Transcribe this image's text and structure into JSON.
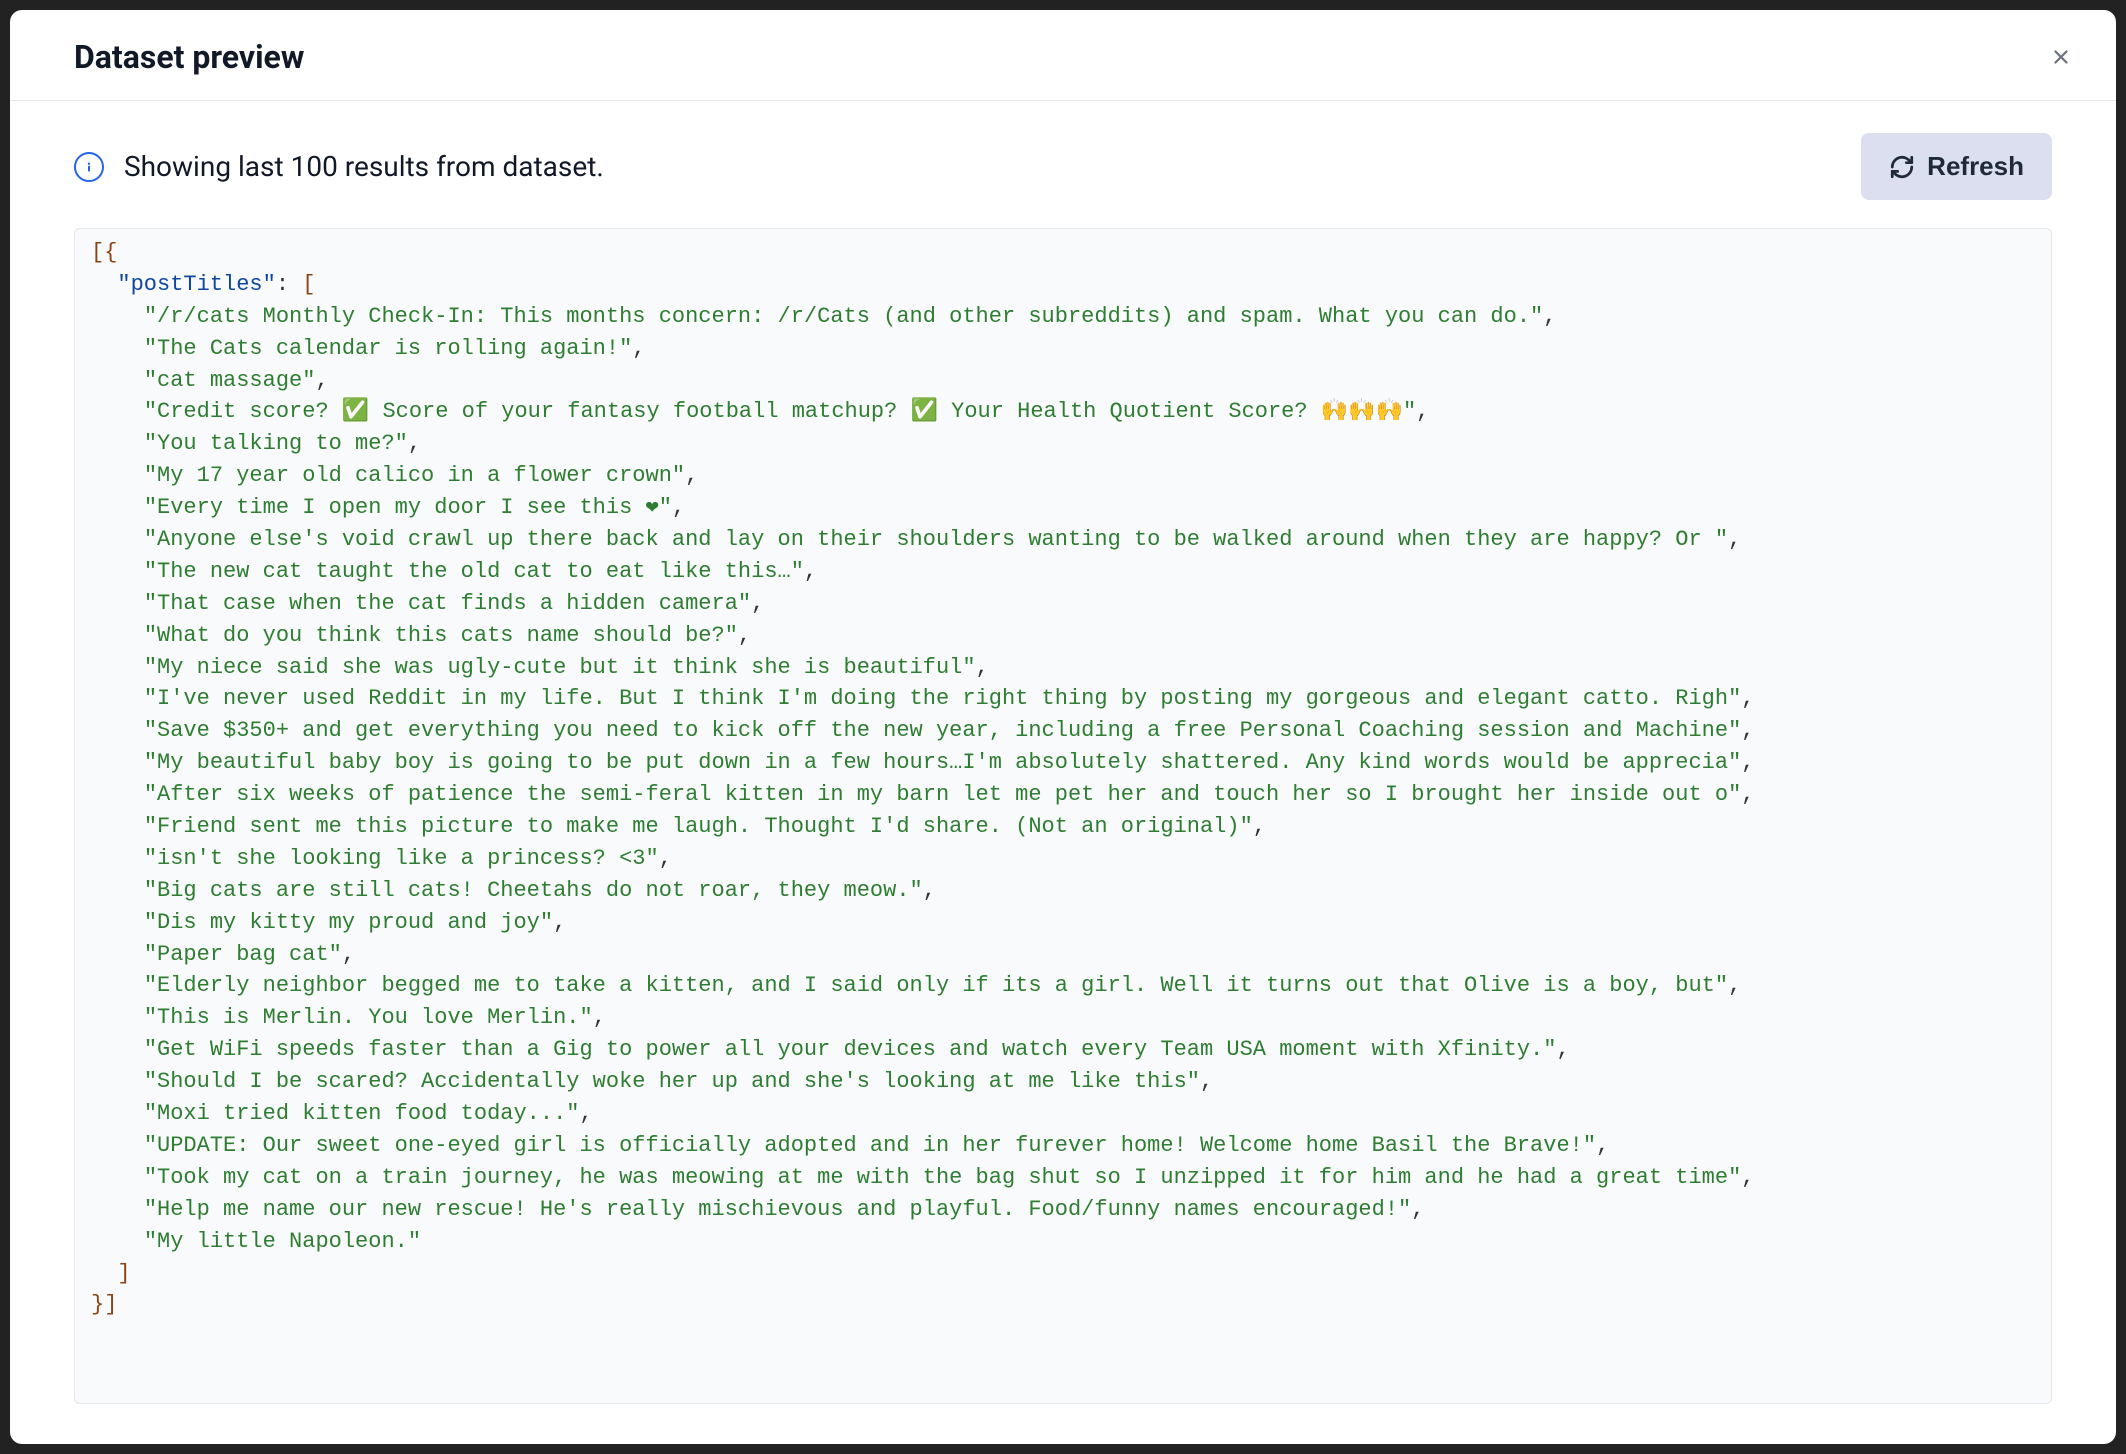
{
  "modal": {
    "title": "Dataset preview",
    "infoText": "Showing last 100 results from dataset.",
    "refreshLabel": "Refresh"
  },
  "dataset": {
    "key": "postTitles",
    "items": [
      "/r/cats Monthly Check-In: This months concern: /r/Cats (and other subreddits) and spam. What you can do.",
      "The Cats calendar is rolling again!",
      "cat massage",
      "Credit score? ✅ Score of your fantasy football matchup? ✅ Your Health Quotient Score? 🙌🙌🙌",
      "You talking to me?",
      "My 17 year old calico in a flower crown",
      "Every time I open my door I see this ❤",
      "Anyone else's void crawl up there back and lay on their shoulders wanting to be walked around when they are happy? Or ",
      "The new cat taught the old cat to eat like this…",
      "That case when the cat finds a hidden camera",
      "What do you think this cats name should be?",
      "My niece said she was ugly-cute but it think she is beautiful",
      "I've never used Reddit in my life. But I think I'm doing the right thing by posting my gorgeous and elegant catto. Righ",
      "Save $350+ and get everything you need to kick off the new year, including a free Personal Coaching session and Machine",
      "My beautiful baby boy is going to be put down in a few hours…I'm absolutely shattered. Any kind words would be apprecia",
      "After six weeks of patience the semi-feral kitten in my barn let me pet her and touch her so I brought her inside out o",
      "Friend sent me this picture to make me laugh. Thought I'd share. (Not an original)",
      "isn't she looking like a princess? <3",
      "Big cats are still cats! Cheetahs do not roar, they meow.",
      "Dis my kitty my proud and joy",
      "Paper bag cat",
      "Elderly neighbor begged me to take a kitten, and I said only if its a girl. Well it turns out that Olive is a boy, but",
      "This is Merlin. You love Merlin.",
      "Get WiFi speeds faster than a Gig to power all your devices and watch every Team USA moment with Xfinity.",
      "Should I be scared? Accidentally woke her up and she's looking at me like this",
      "Moxi tried kitten food today...",
      "UPDATE: Our sweet one-eyed girl is officially adopted and in her furever home! Welcome home Basil the Brave!",
      "Took my cat on a train journey, he was meowing at me with the bag shut so I unzipped it for him and he had a great time",
      "Help me name our new rescue! He's really mischievous and playful. Food/funny names encouraged!",
      "My little Napoleon."
    ]
  }
}
